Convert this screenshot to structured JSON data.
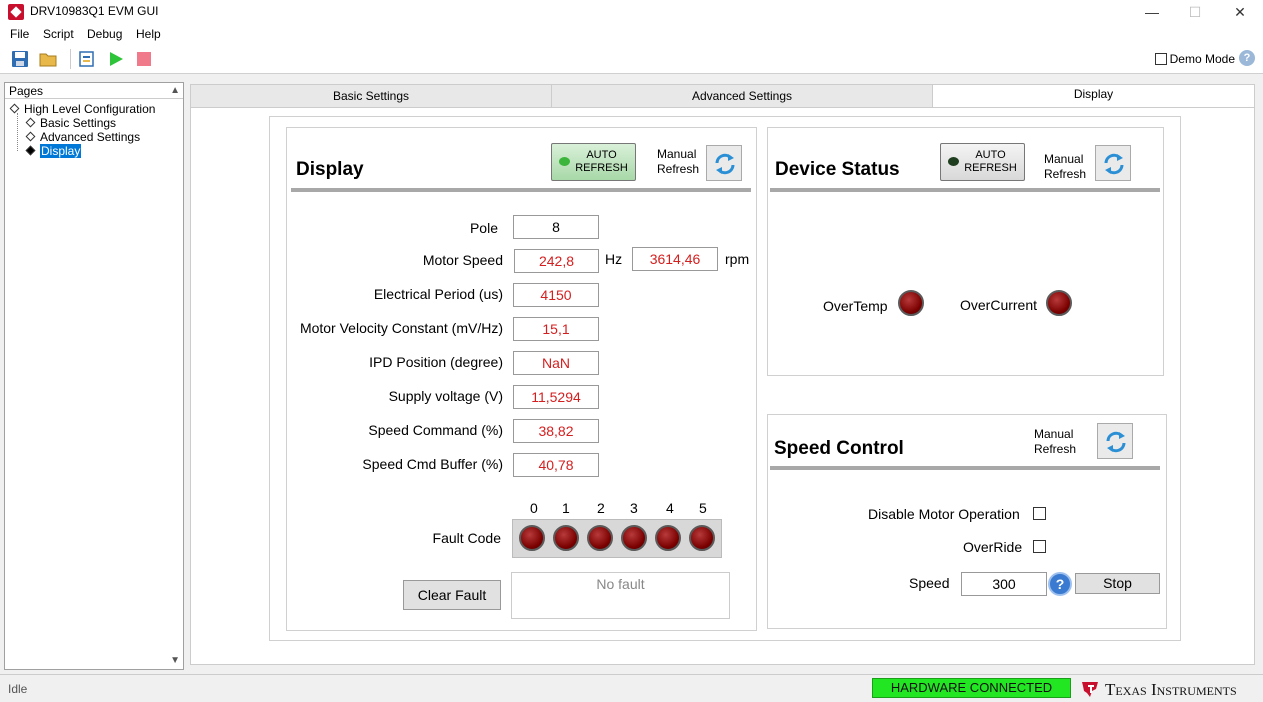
{
  "window": {
    "title": "DRV10983Q1 EVM GUI",
    "minimize": "—",
    "maximize": "☐",
    "close": "✕"
  },
  "menu": [
    "File",
    "Script",
    "Debug",
    "Help"
  ],
  "toolbar": {
    "demo_mode_label": "Demo Mode",
    "help": "?"
  },
  "pages": {
    "header": "Pages",
    "tree": [
      {
        "label": "High Level Configuration"
      },
      {
        "label": "Basic Settings"
      },
      {
        "label": "Advanced Settings"
      },
      {
        "label": "Display"
      }
    ]
  },
  "tabs": [
    "Basic Settings",
    "Advanced Settings",
    "Display"
  ],
  "display": {
    "title": "Display",
    "auto_refresh": {
      "line1": "AUTO",
      "line2": "REFRESH"
    },
    "manual_refresh": {
      "line1": "Manual",
      "line2": "Refresh"
    },
    "fields": [
      {
        "label": "Pole",
        "value": "8"
      },
      {
        "label": "Motor Speed",
        "value": "242,8",
        "unit": "Hz",
        "value2": "3614,46",
        "unit2": "rpm"
      },
      {
        "label": "Electrical Period (us)",
        "value": "4150"
      },
      {
        "label": "Motor Velocity Constant (mV/Hz)",
        "value": "15,1"
      },
      {
        "label": "IPD Position (degree)",
        "value": "NaN"
      },
      {
        "label": "Supply voltage (V)",
        "value": "11,5294"
      },
      {
        "label": "Speed Command (%)",
        "value": "38,82"
      },
      {
        "label": "Speed Cmd Buffer (%)",
        "value": "40,78"
      }
    ],
    "fault_code_label": "Fault Code",
    "fault_bits": [
      "0",
      "1",
      "2",
      "3",
      "4",
      "5"
    ],
    "clear_fault": "Clear Fault",
    "fault_message": "No fault"
  },
  "device_status": {
    "title": "Device Status",
    "auto_refresh": {
      "line1": "AUTO",
      "line2": "REFRESH"
    },
    "manual_refresh": {
      "line1": "Manual",
      "line2": "Refresh"
    },
    "overtemp": "OverTemp",
    "overcurrent": "OverCurrent"
  },
  "speed_control": {
    "title": "Speed Control",
    "manual_refresh": {
      "line1": "Manual",
      "line2": "Refresh"
    },
    "disable_motor": "Disable Motor Operation",
    "override": "OverRide",
    "speed_label": "Speed",
    "speed_value": "300",
    "help": "?",
    "stop": "Stop"
  },
  "statusbar": {
    "state": "Idle",
    "hardware": "HARDWARE CONNECTED",
    "brand": "Texas Instruments"
  },
  "colors": {
    "value_red": "#d41f1f",
    "hw_green": "#22e622",
    "led_red": "#7a0000",
    "selection": "#0078d7"
  }
}
